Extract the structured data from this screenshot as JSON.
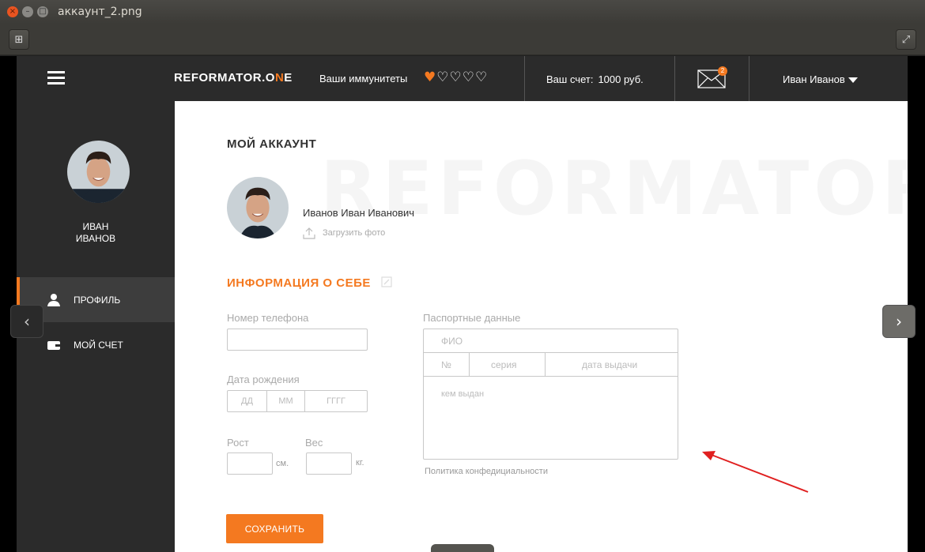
{
  "window": {
    "title": "аккаунт_2.png",
    "close_glyph": "×",
    "min_glyph": "–",
    "max_glyph": "□"
  },
  "toolbar": {
    "add_glyph": "⊞",
    "fullscreen_glyph": "⤢"
  },
  "header": {
    "logo_main": "REFORMATOR.O",
    "logo_accent": "N",
    "logo_end": "E",
    "immunities_label": "Ваши иммунитеты",
    "immunities_full": 1,
    "immunities_total": 5,
    "heart_full": "♥",
    "heart_empty": "♡♡♡♡",
    "balance_label": "Ваш счет:",
    "balance_value": "1000 руб.",
    "mail_count": "2",
    "user_name": "Иван Иванов"
  },
  "sidebar": {
    "name_line1": "ИВАН",
    "name_line2": "ИВАНОВ",
    "items": [
      {
        "label": "ПРОФИЛЬ",
        "icon": "user-icon",
        "active": true
      },
      {
        "label": "МОЙ СЧЕТ",
        "icon": "wallet-icon",
        "active": false
      }
    ]
  },
  "main": {
    "watermark": "REFORMATOR",
    "title": "МОЙ АККАУНТ",
    "full_name": "Иванов Иван Иванович",
    "upload_label": "Загрузить фото",
    "section_title": "ИНФОРМАЦИЯ О СЕБЕ",
    "phone_label": "Номер телефона",
    "phone_value": "",
    "birth_label": "Дата рождения",
    "birth_day": "ДД",
    "birth_month": "ММ",
    "birth_year": "ГГГГ",
    "height_label": "Рост",
    "height_unit": "см.",
    "weight_label": "Вес",
    "weight_unit": "кг.",
    "passport_label": "Паспортные данные",
    "passport_fio": "ФИО",
    "passport_number": "№",
    "passport_series": "серия",
    "passport_date": "дата выдачи",
    "passport_issuer": "кем выдан",
    "policy": "Политика конфедициальности",
    "save_label": "СОХРАНИТЬ"
  },
  "viewer_nav": {
    "prev_glyph": "‹",
    "next_glyph": "›"
  },
  "colors": {
    "accent": "#f47920",
    "dark": "#2b2b2b",
    "annotation_arrow": "#e02020"
  }
}
